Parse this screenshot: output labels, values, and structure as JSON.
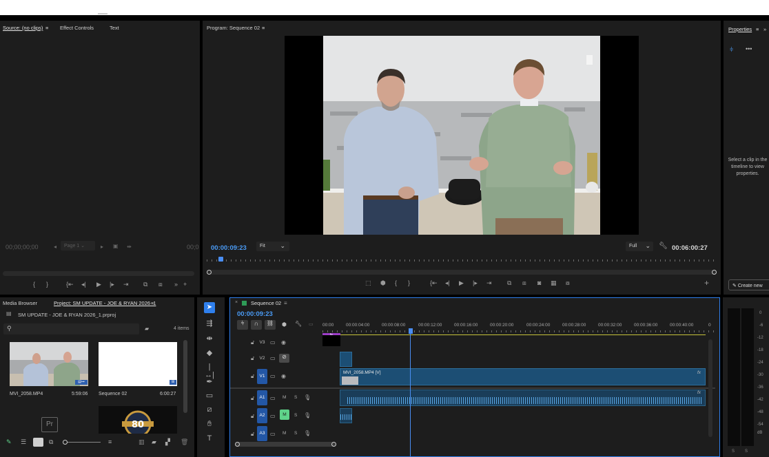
{
  "source_panel": {
    "tabs": [
      "Source: (no clips)",
      "Effect Controls",
      "Text"
    ],
    "timecode_left": "00;00;00;00",
    "page_select": "Page 1",
    "timecode_right": "00;0"
  },
  "program_panel": {
    "title": "Program: Sequence 02",
    "timecode": "00:00:09:23",
    "fit": "Fit",
    "quality": "Full",
    "duration": "00:06:00:27"
  },
  "properties_panel": {
    "title": "Properties",
    "message": "Select a clip in the timeline to view properties.",
    "create_new": "Create new"
  },
  "project_panel": {
    "tabs": [
      "Media Browser",
      "Project: SM UPDATE - JOE & RYAN 2026_1"
    ],
    "project_file": "SM UPDATE - JOE & RYAN 2026_1.prproj",
    "items_count": "4 items",
    "items": [
      {
        "name": "MVI_2058.MP4",
        "duration": "5:59:06"
      },
      {
        "name": "Sequence 02",
        "duration": "6:00:27"
      }
    ],
    "logo_text": "80"
  },
  "timeline": {
    "sequence": "Sequence 02",
    "timecode": "00:00:09:23",
    "ruler": [
      "00:00",
      "00:00:04:00",
      "00:00:08:00",
      "00:00:12:00",
      "00:00:16:00",
      "00:00:20:00",
      "00:00:24:00",
      "00:00:28:00",
      "00:00:32:00",
      "00:00:36:00",
      "00:00:40:00",
      "0"
    ],
    "video_tracks": [
      "V3",
      "V2",
      "V1"
    ],
    "audio_tracks": [
      "A1",
      "A2",
      "A3"
    ],
    "clip_label": "MVI_2058.MP4 [V]",
    "fx": "fx",
    "m": "M",
    "s": "S"
  },
  "meter": {
    "ticks": [
      "0",
      "-6",
      "-12",
      "-18",
      "-24",
      "-30",
      "-36",
      "-42",
      "-48",
      "-54",
      "dB"
    ],
    "bottom": [
      "S",
      "S"
    ]
  },
  "colors": {
    "accent_blue": "#2f80ed",
    "timecode_blue": "#4a9bf5",
    "track_blue": "#2357a6",
    "mute_green": "#5fd38a"
  }
}
